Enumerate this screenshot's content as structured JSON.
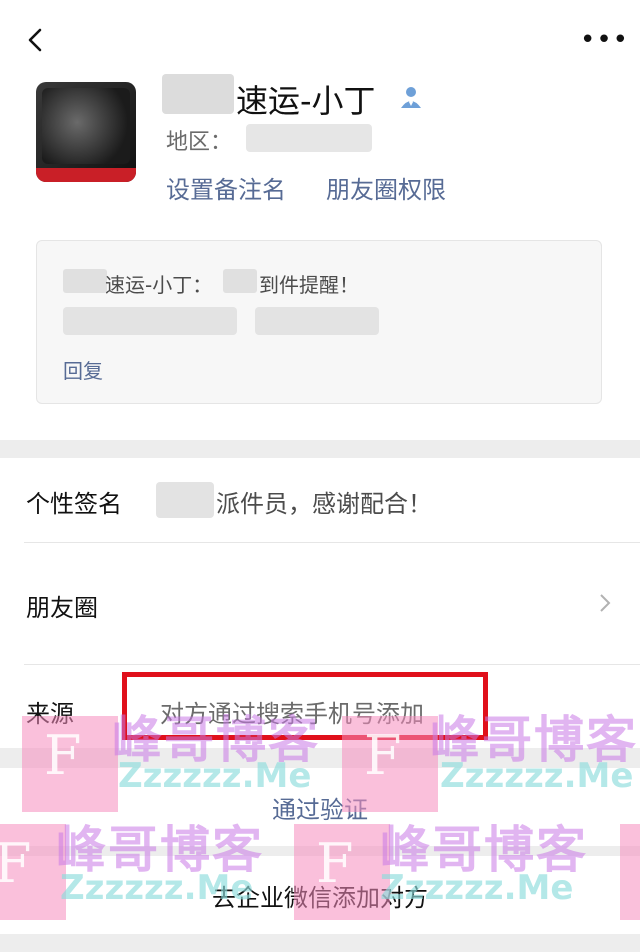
{
  "header": {
    "back_icon": "back-arrow-icon",
    "more_icon": "more-dots-icon"
  },
  "profile": {
    "nickname": "速运-小丁",
    "region_label": "地区：",
    "verified_icon": "user-icon",
    "links": {
      "remark": "设置备注名",
      "moments_permission": "朋友圈权限"
    }
  },
  "message": {
    "line1_part1": "速运-小丁：",
    "line1_part2": "到件提醒！",
    "reply": "回复"
  },
  "info": {
    "signature_label": "个性签名",
    "signature_value": "派件员，感谢配合！",
    "moments_label": "朋友圈",
    "source_label": "来源",
    "source_value": "对方通过搜索手机号添加"
  },
  "actions": {
    "verify": "通过验证",
    "wecom_add": "去企业微信添加对方"
  },
  "watermark": {
    "cn": "峰哥博客",
    "en": "Zzzzzz.Me",
    "letter": "F"
  },
  "colors": {
    "link": "#576b95",
    "highlight_box": "#e0101b",
    "background": "#ededed"
  }
}
